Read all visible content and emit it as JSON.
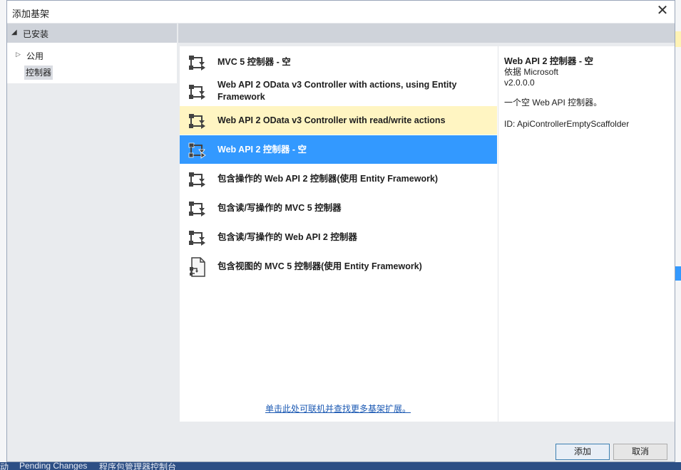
{
  "dialog": {
    "title": "添加基架",
    "close_glyph": "✕"
  },
  "tree": {
    "header": "已安装",
    "items": [
      {
        "label": "公用"
      },
      {
        "label": "控制器"
      }
    ]
  },
  "templates": [
    {
      "label": "MVC 5 控制器 - 空",
      "icon": "controller-icon"
    },
    {
      "label": "Web API 2 OData v3 Controller with actions, using Entity Framework",
      "icon": "controller-icon"
    },
    {
      "label": "Web API 2 OData v3 Controller with read/write actions",
      "icon": "controller-icon"
    },
    {
      "label": "Web API 2 控制器 - 空",
      "icon": "controller-icon"
    },
    {
      "label": "包含操作的 Web API 2 控制器(使用 Entity Framework)",
      "icon": "controller-icon"
    },
    {
      "label": "包含读/写操作的 MVC 5 控制器",
      "icon": "controller-icon"
    },
    {
      "label": "包含读/写操作的 Web API 2 控制器",
      "icon": "controller-icon"
    },
    {
      "label": "包含视图的 MVC 5 控制器(使用 Entity Framework)",
      "icon": "view-document-icon"
    }
  ],
  "online_link": "单击此处可联机并查找更多基架扩展。",
  "details": {
    "title": "Web API 2 控制器 - 空",
    "author": "依据 Microsoft",
    "version": "v2.0.0.0",
    "description": "一个空 Web API 控制器。",
    "id": "ID: ApiControllerEmptyScaffolder"
  },
  "buttons": {
    "add": "添加",
    "cancel": "取消"
  },
  "statusbar": {
    "items": [
      "动",
      "Pending Changes",
      "程序包管理器控制台"
    ]
  },
  "colors": {
    "selected": "#3399ff",
    "hover": "#fff5c2",
    "link": "#1b59b3"
  }
}
